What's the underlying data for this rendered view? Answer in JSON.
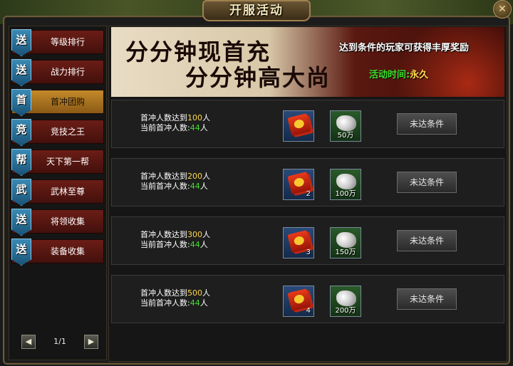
{
  "window": {
    "title": "开服活动",
    "close_symbol": "✕"
  },
  "sidebar": {
    "tabs": [
      {
        "badge": "送",
        "label": "等级排行",
        "active": false
      },
      {
        "badge": "送",
        "label": "战力排行",
        "active": false
      },
      {
        "badge": "首",
        "label": "首冲团购",
        "active": true
      },
      {
        "badge": "竞",
        "label": "竞技之王",
        "active": false
      },
      {
        "badge": "帮",
        "label": "天下第一帮",
        "active": false
      },
      {
        "badge": "武",
        "label": "武林至尊",
        "active": false
      },
      {
        "badge": "送",
        "label": "将领收集",
        "active": false
      },
      {
        "badge": "送",
        "label": "装备收集",
        "active": false
      }
    ],
    "pager": {
      "prev": "◀",
      "next": "▶",
      "text": "1/1"
    }
  },
  "banner": {
    "line1": "分分钟现首充",
    "line2": "分分钟高大尚",
    "description": "达到条件的玩家可获得丰厚奖励",
    "time_label": "活动时间:",
    "time_value": "永久"
  },
  "rows": [
    {
      "req_prefix": "首冲人数达到",
      "req_num": "100",
      "req_suffix": "人",
      "cur_prefix": "当前首冲人数:",
      "cur_num": "44",
      "cur_suffix": "人",
      "red_qty": "",
      "silver_qty": "50万",
      "status": "未达条件"
    },
    {
      "req_prefix": "首冲人数达到",
      "req_num": "200",
      "req_suffix": "人",
      "cur_prefix": "当前首冲人数:",
      "cur_num": "44",
      "cur_suffix": "人",
      "red_qty": "2",
      "silver_qty": "100万",
      "status": "未达条件"
    },
    {
      "req_prefix": "首冲人数达到",
      "req_num": "300",
      "req_suffix": "人",
      "cur_prefix": "当前首冲人数:",
      "cur_num": "44",
      "cur_suffix": "人",
      "red_qty": "3",
      "silver_qty": "150万",
      "status": "未达条件"
    },
    {
      "req_prefix": "首冲人数达到",
      "req_num": "500",
      "req_suffix": "人",
      "cur_prefix": "当前首冲人数:",
      "cur_num": "44",
      "cur_suffix": "人",
      "red_qty": "4",
      "silver_qty": "200万",
      "status": "未达条件"
    }
  ],
  "colors": {
    "highlight_number": "#ffd84a",
    "current_number": "#44e030",
    "time_label": "#3ce02c"
  }
}
